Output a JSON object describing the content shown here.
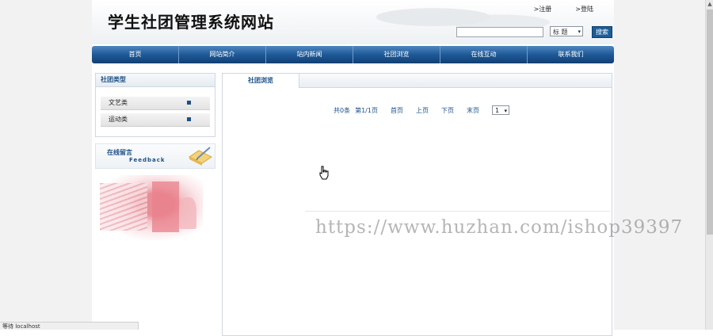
{
  "header": {
    "title": "学生社团管理系统网站",
    "links": {
      "register": ">注册",
      "login": ">登陆"
    },
    "search": {
      "placeholder": "",
      "select_value": "标  题",
      "button": "搜索"
    }
  },
  "nav": {
    "items": [
      "首页",
      "网站简介",
      "站内新闻",
      "社团浏览",
      "在线互动",
      "联系我们"
    ]
  },
  "sidebar": {
    "category_title": "社团类型",
    "categories": [
      "文艺类",
      "运动类"
    ],
    "feedback": {
      "title": "在线留言",
      "subtitle": "Feedback"
    }
  },
  "main": {
    "tab_label": "社团浏览",
    "pager": {
      "total": "共0条",
      "page": "第1/1页",
      "first": "首页",
      "prev": "上页",
      "next": "下页",
      "last": "末页",
      "select_value": "1"
    }
  },
  "watermark": "https://www.huzhan.com/ishop39397",
  "status_bar": "等待 localhost",
  "colors": {
    "nav": "#1e5a98",
    "accent": "#1b4f86",
    "search_button": "#1b5e98"
  },
  "icons": {
    "cursor": "hand-cursor-icon",
    "feedback": "pen-note-icon"
  }
}
